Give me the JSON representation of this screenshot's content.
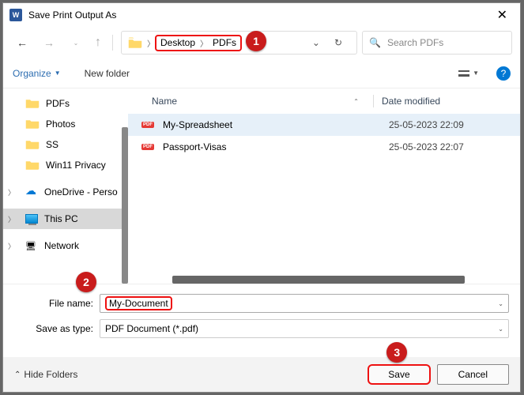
{
  "title": "Save Print Output As",
  "breadcrumb": {
    "a": "Desktop",
    "b": "PDFs"
  },
  "search_placeholder": "Search PDFs",
  "toolbar": {
    "organize": "Organize",
    "new_folder": "New folder"
  },
  "sidebar": {
    "pdfs": "PDFs",
    "photos": "Photos",
    "ss": "SS",
    "win11": "Win11 Privacy",
    "onedrive": "OneDrive - Perso",
    "thispc": "This PC",
    "network": "Network"
  },
  "columns": {
    "name": "Name",
    "date": "Date modified"
  },
  "files": [
    {
      "name": "My-Spreadsheet",
      "date": "25-05-2023 22:09"
    },
    {
      "name": "Passport-Visas",
      "date": "25-05-2023 22:07"
    }
  ],
  "form": {
    "filename_label": "File name:",
    "filename_value": "My-Document",
    "type_label": "Save as type:",
    "type_value": "PDF Document (*.pdf)"
  },
  "footer": {
    "hide": "Hide Folders",
    "save": "Save",
    "cancel": "Cancel"
  },
  "callouts": {
    "one": "1",
    "two": "2",
    "three": "3"
  },
  "help": "?"
}
